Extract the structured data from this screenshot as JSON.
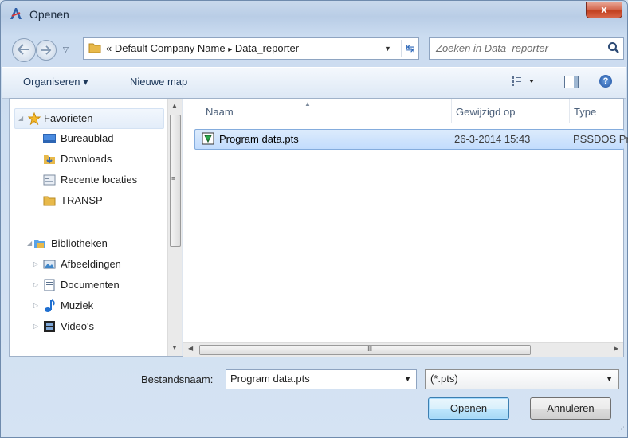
{
  "window": {
    "title": "Openen",
    "close_label": "x"
  },
  "address": {
    "prefix": "«",
    "crumb1": "Default Company Name",
    "sep": "▸",
    "crumb2": "Data_reporter"
  },
  "search": {
    "placeholder": "Zoeken in Data_reporter"
  },
  "toolbar": {
    "organize": "Organiseren ▾",
    "new_folder": "Nieuwe map",
    "help": "?"
  },
  "nav": {
    "favorites": "Favorieten",
    "fav_items": [
      "Bureaublad",
      "Downloads",
      "Recente locaties",
      "TRANSP"
    ],
    "libraries": "Bibliotheken",
    "lib_items": [
      "Afbeeldingen",
      "Documenten",
      "Muziek",
      "Video's"
    ]
  },
  "columns": {
    "name": "Naam",
    "modified": "Gewijzigd op",
    "type": "Type"
  },
  "files": [
    {
      "name": "Program data.pts",
      "modified": "26-3-2014 15:43",
      "type": "PSSDOS Pr"
    }
  ],
  "footer": {
    "filename_label": "Bestandsnaam:",
    "filename_value": "Program data.pts",
    "filter_value": "(*.pts)",
    "open_label": "Openen",
    "cancel_label": "Annuleren"
  },
  "colors": {
    "accent": "#3c7fb1",
    "selection": "#c2dcfd",
    "close": "#c2401f"
  }
}
